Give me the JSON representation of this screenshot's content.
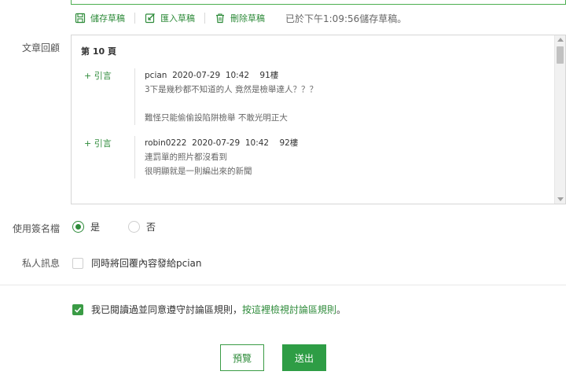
{
  "draft_bar": {
    "save_label": "儲存草稿",
    "import_label": "匯入草稿",
    "delete_label": "刪除草稿",
    "status": "已於下午1:09:56儲存草稿。"
  },
  "review": {
    "label": "文章回顧",
    "page_title": "第 10 頁",
    "posts": [
      {
        "quote_label": "+ 引言",
        "meta": "pcian  2020-07-29  10:42    91樓",
        "lines": [
          "3下是幾秒都不知道的人 竟然是檢舉達人？？？",
          "",
          "難怪只能偷偷設陷阱檢舉 不敢光明正大"
        ]
      },
      {
        "quote_label": "+ 引言",
        "meta": "robin0222  2020-07-29  10:42    92樓",
        "lines": [
          "連罰單的照片都沒看到",
          "很明顯就是一則編出來的新聞"
        ]
      }
    ]
  },
  "signature": {
    "label": "使用簽名檔",
    "options": [
      {
        "label": "是",
        "checked": true
      },
      {
        "label": "否",
        "checked": false
      }
    ]
  },
  "private_message": {
    "label": "私人訊息",
    "checkbox_label": "同時將回覆內容發給pcian",
    "checked": false
  },
  "agreement": {
    "text": "我已閱讀過並同意遵守討論區規則，",
    "link": "按這裡檢視討論區規則",
    "suffix": "。",
    "checked": true
  },
  "actions": {
    "preview_label": "預覽",
    "submit_label": "送出"
  },
  "colors": {
    "accent": "#2e8b3a",
    "button_green": "#2e9d45"
  }
}
